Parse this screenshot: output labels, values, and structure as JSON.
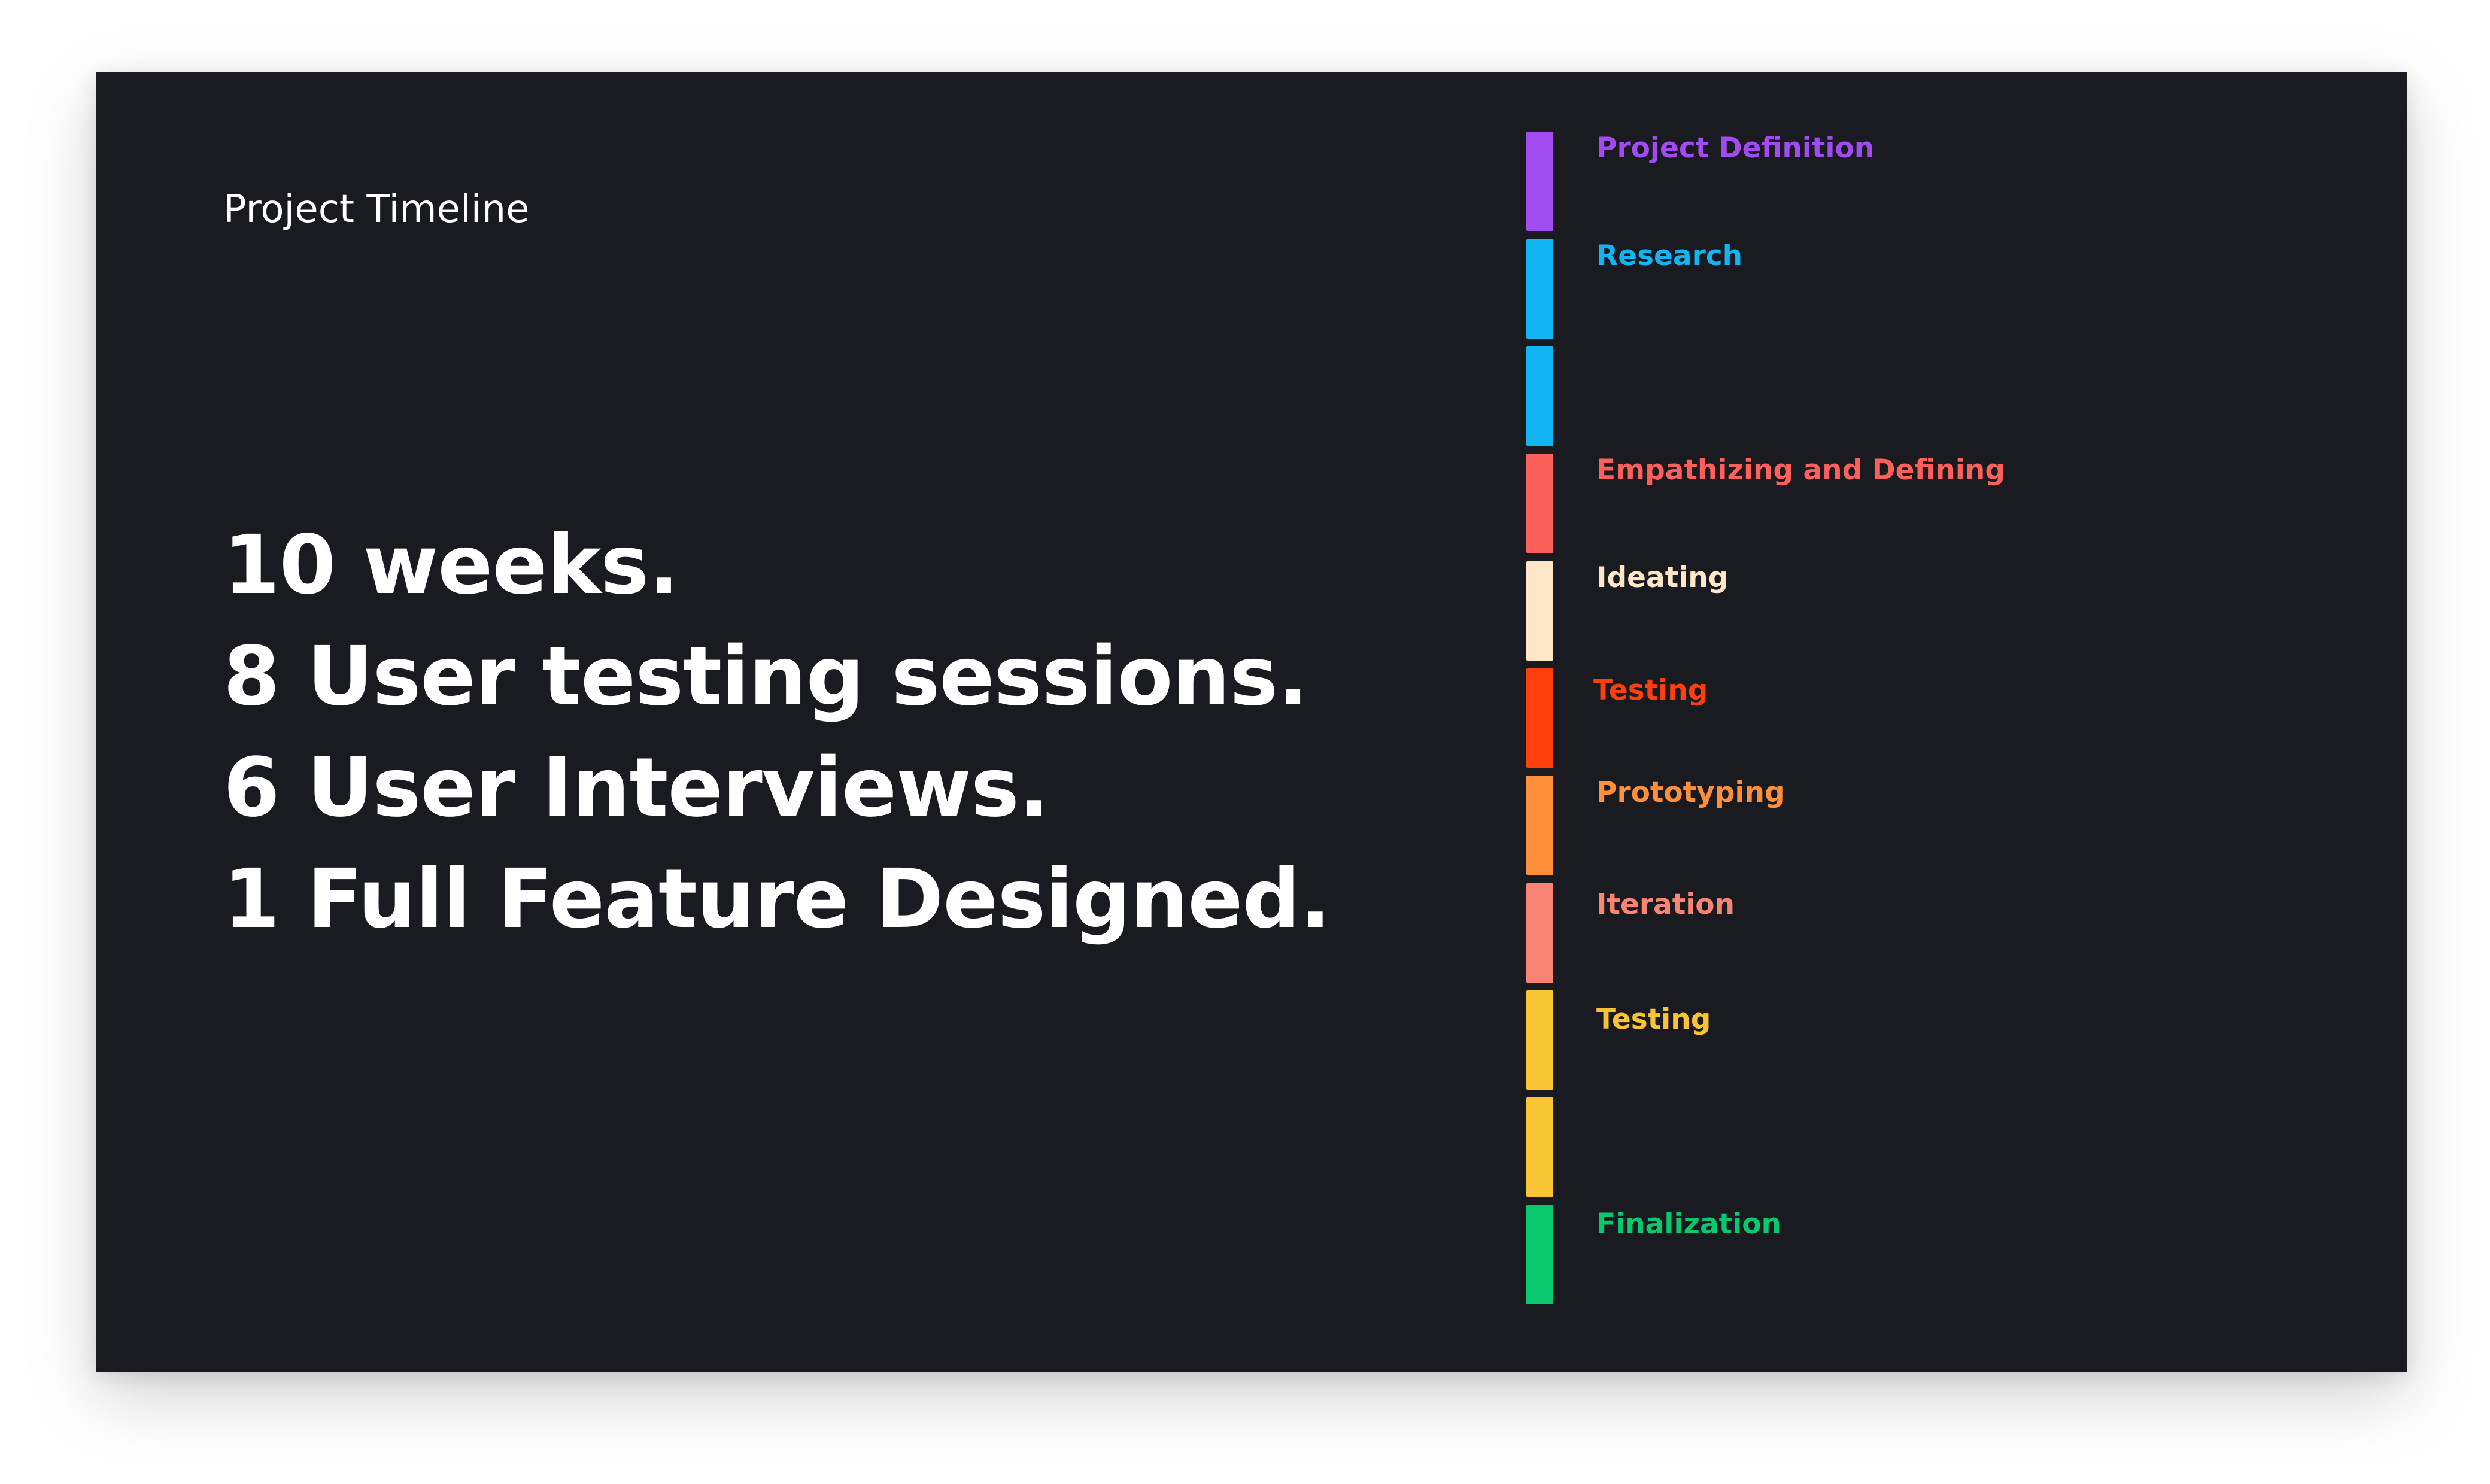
{
  "title": "Project Timeline",
  "headline": [
    "10 weeks.",
    "8 User testing sessions.",
    "6 User Interviews.",
    "1 Full Feature Designed."
  ],
  "colors": {
    "background": "#191b20",
    "text": "#ffffff"
  },
  "timeline": {
    "segments": [
      {
        "color": "#a24bf0"
      },
      {
        "color": "#13b4f2"
      },
      {
        "color": "#13b4f2"
      },
      {
        "color": "#fb605b"
      },
      {
        "color": "#fde7c8"
      },
      {
        "color": "#ff3f0e"
      },
      {
        "color": "#ff8f3b"
      },
      {
        "color": "#fa8474"
      },
      {
        "color": "#f8c433"
      },
      {
        "color": "#f8c433"
      },
      {
        "color": "#0ac86e"
      }
    ],
    "phases": [
      {
        "label": "Project Definition",
        "color": "#a24bf0"
      },
      {
        "label": "Research",
        "color": "#13b4f2"
      },
      {
        "label": "Empathizing and Defining",
        "color": "#fb605b"
      },
      {
        "label": "Ideating",
        "color": "#fde7c8"
      },
      {
        "label": "Testing",
        "color": "#ff3f0e"
      },
      {
        "label": "Prototyping",
        "color": "#ff8f3b"
      },
      {
        "label": "Iteration",
        "color": "#fa8474"
      },
      {
        "label": "Testing",
        "color": "#f8c433"
      },
      {
        "label": "Finalization",
        "color": "#0ac86e"
      }
    ]
  }
}
